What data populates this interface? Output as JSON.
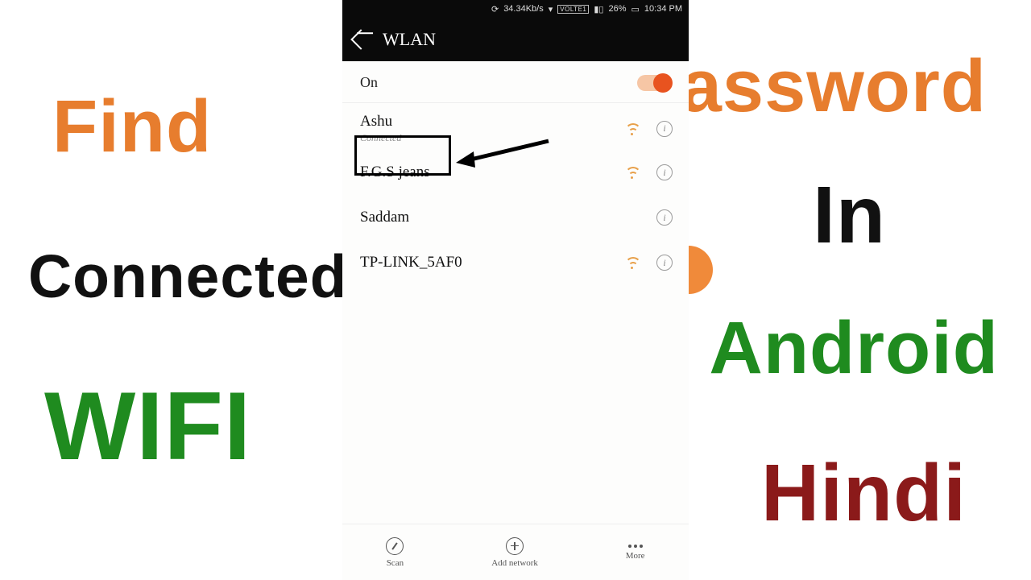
{
  "left_words": {
    "find": "Find",
    "connected": "Connected",
    "wifi": "WIFI"
  },
  "right_words": {
    "password": "Password",
    "in": "In",
    "android": "Android",
    "hindi": "Hindi"
  },
  "statusbar": {
    "speed": "34.34Kb/s",
    "volte": "VOLTE1",
    "battery_pct": "26%",
    "time": "10:34 PM"
  },
  "appbar": {
    "title": "WLAN"
  },
  "toggle": {
    "label": "On",
    "state": "on"
  },
  "networks": [
    {
      "name": "Ashu",
      "sub": "Connected"
    },
    {
      "name": "F.G.S jeans",
      "sub": ""
    },
    {
      "name": "Saddam",
      "sub": ""
    },
    {
      "name": "TP-LINK_5AF0",
      "sub": ""
    }
  ],
  "bottom": {
    "scan": "Scan",
    "add": "Add network",
    "more": "More"
  }
}
